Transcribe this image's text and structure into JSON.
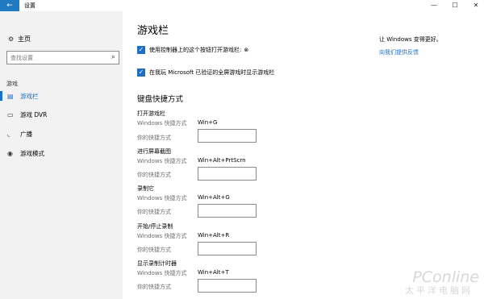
{
  "window": {
    "title": "设置",
    "back_icon": "arrow-left-icon",
    "minimize_glyph": "—",
    "maximize_glyph": "☐",
    "close_glyph": "✕"
  },
  "sidebar": {
    "home_label": "主页",
    "search_placeholder": "查找设置",
    "group_label": "游戏",
    "items": [
      {
        "icon": "gamebar-icon",
        "label": "游戏栏",
        "active": true
      },
      {
        "icon": "dvr-icon",
        "label": "游戏 DVR",
        "active": false
      },
      {
        "icon": "broadcast-icon",
        "label": "广播",
        "active": false
      },
      {
        "icon": "game-mode-icon",
        "label": "游戏模式",
        "active": false
      }
    ]
  },
  "main": {
    "title": "游戏栏",
    "checkboxes": [
      {
        "label": "使用控制器上的这个按钮打开游戏栏:",
        "checked": true,
        "icon": "xbox-icon"
      },
      {
        "label": "在我玩 Microsoft 已验证的全屏游戏时显示游戏栏",
        "checked": true
      }
    ],
    "shortcuts_title": "键盘快捷方式",
    "windows_shortcut_label": "Windows 快捷方式",
    "your_shortcut_label": "你的快捷方式",
    "shortcuts": [
      {
        "title": "打开游戏栏",
        "windows": "Win+G",
        "custom": ""
      },
      {
        "title": "进行屏幕截图",
        "windows": "Win+Alt+PrtScrn",
        "custom": ""
      },
      {
        "title": "录制它",
        "windows": "Win+Alt+G",
        "custom": ""
      },
      {
        "title": "开始/停止录制",
        "windows": "Win+Alt+R",
        "custom": ""
      },
      {
        "title": "显示录制计时器",
        "windows": "Win+Alt+T",
        "custom": ""
      }
    ]
  },
  "aside": {
    "note": "让 Windows 变得更好。",
    "link": "向我们提供反馈"
  },
  "watermark": {
    "brand": "PConline",
    "subtitle": "太平洋电脑网"
  },
  "colors": {
    "accent": "#1e6ec2",
    "back_button": "#1f7ac2",
    "sidebar_bg": "#f2f2f2"
  }
}
